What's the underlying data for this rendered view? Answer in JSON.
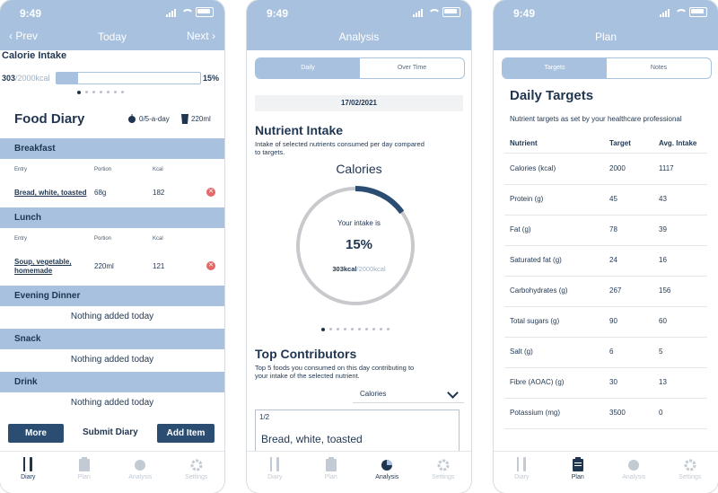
{
  "status": {
    "time": "9:49"
  },
  "screen1": {
    "nav": {
      "prev": "Prev",
      "title": "Today",
      "next": "Next"
    },
    "calorie": {
      "title": "Calorie Intake",
      "consumed": "303",
      "target": "/2000kcal",
      "percent_label": "15%",
      "progress": 0.15
    },
    "food_diary": {
      "title": "Food Diary",
      "five_a_day": "0/5-a-day",
      "water": "220ml",
      "columns": {
        "entry": "Entry",
        "portion": "Portion",
        "kcal": "Kcal"
      },
      "breakfast": {
        "label": "Breakfast",
        "entry": {
          "name": "Bread, white, toasted",
          "portion": "68g",
          "kcal": "182"
        }
      },
      "lunch": {
        "label": "Lunch",
        "entry": {
          "name1": "Soup, vegetable,",
          "name2": "homemade",
          "portion": "220ml",
          "kcal": "121"
        }
      },
      "evening": {
        "label": "Evening Dinner",
        "empty": "Nothing added today"
      },
      "snack": {
        "label": "Snack",
        "empty": "Nothing added today"
      },
      "drink": {
        "label": "Drink",
        "empty": "Nothing added today"
      }
    },
    "buttons": {
      "more": "More",
      "submit": "Submit Diary",
      "add": "Add Item"
    }
  },
  "screen2": {
    "nav": {
      "title": "Analysis"
    },
    "segments": {
      "daily": "Daily",
      "over_time": "Over Time"
    },
    "date": "17/02/2021",
    "nutrient": {
      "title": "Nutrient Intake",
      "desc1": "Intake of selected nutrients consumed per day compared",
      "desc2": "to targets.",
      "ring_title": "Calories",
      "your_intake": "Your intake is",
      "percent": "15%",
      "consumed": "303kcal",
      "target": "/2000kcal",
      "progress": 0.15
    },
    "contributors": {
      "title": "Top Contributors",
      "desc1": "Top 5 foods you consumed on this day contributing to",
      "desc2": "your intake of the selected nutrient.",
      "select": "Calories",
      "count": "1/2",
      "item": "Bread, white, toasted"
    }
  },
  "screen3": {
    "nav": {
      "title": "Plan"
    },
    "segments": {
      "targets": "Targets",
      "notes": "Notes"
    },
    "title": "Daily Targets",
    "subtitle": "Nutrient targets as set by your healthcare professional",
    "headers": {
      "nutrient": "Nutrient",
      "target": "Target",
      "avg": "Avg. Intake"
    },
    "rows": [
      {
        "nutrient": "Calories (kcal)",
        "target": "2000",
        "avg": "1117"
      },
      {
        "nutrient": "Protein (g)",
        "target": "45",
        "avg": "43"
      },
      {
        "nutrient": "Fat (g)",
        "target": "78",
        "avg": "39"
      },
      {
        "nutrient": "Saturated fat (g)",
        "target": "24",
        "avg": "16"
      },
      {
        "nutrient": "Carbohydrates (g)",
        "target": "267",
        "avg": "156"
      },
      {
        "nutrient": "Total sugars (g)",
        "target": "90",
        "avg": "60"
      },
      {
        "nutrient": "Salt (g)",
        "target": "6",
        "avg": "5"
      },
      {
        "nutrient": "Fibre (AOAC) (g)",
        "target": "30",
        "avg": "13"
      },
      {
        "nutrient": "Potassium (mg)",
        "target": "3500",
        "avg": "0"
      }
    ]
  },
  "tabs": {
    "diary": "Diary",
    "plan": "Plan",
    "analysis": "Analysis",
    "settings": "Settings"
  },
  "colors": {
    "header": "#a8c1df",
    "navy": "#1f3550",
    "button": "#2c4d72",
    "delete": "#e46a6a"
  }
}
